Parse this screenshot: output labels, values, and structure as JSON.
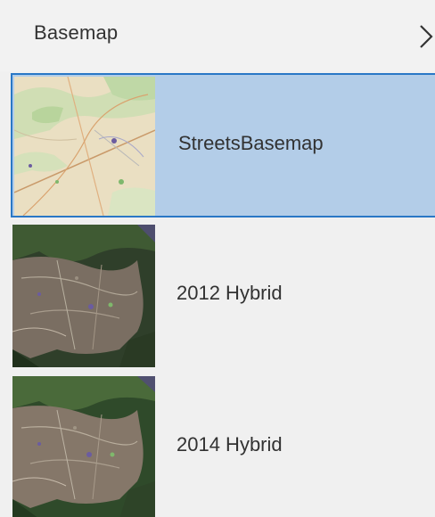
{
  "header": {
    "title": "Basemap",
    "close_icon": "chevron-right-icon"
  },
  "basemaps": [
    {
      "label": "StreetsBasemap",
      "thumbnail": "street-map-thumbnail",
      "selected": true
    },
    {
      "label": "2012 Hybrid",
      "thumbnail": "aerial-hybrid-thumbnail",
      "selected": false
    },
    {
      "label": "2014 Hybrid",
      "thumbnail": "aerial-hybrid-thumbnail",
      "selected": false
    }
  ],
  "colors": {
    "selected_background": "#b3cde8",
    "selected_border": "#2a78c6",
    "panel_background": "#f0f0f0",
    "text": "#323232"
  }
}
